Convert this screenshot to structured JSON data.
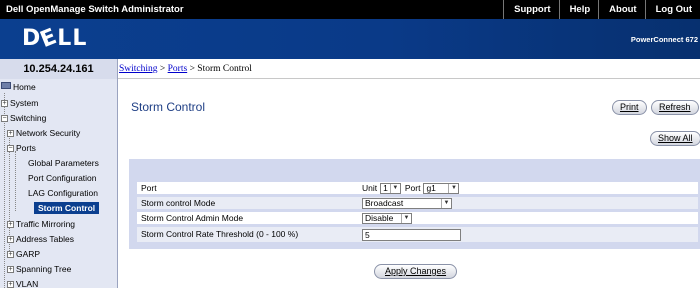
{
  "app": {
    "title": "Dell OpenManage Switch Administrator",
    "nav": [
      "Support",
      "Help",
      "About",
      "Log Out"
    ],
    "logo": "DELL",
    "product": "PowerConnect 672"
  },
  "ip_address": "10.254.24.161",
  "breadcrumb": {
    "items": [
      "Switching",
      "Ports"
    ],
    "separator": ">",
    "current": "Storm Control"
  },
  "sidebar": {
    "items": [
      {
        "label": "Home",
        "icon": "home-icon"
      },
      {
        "label": "System",
        "toggle": "+"
      },
      {
        "label": "Switching",
        "toggle": "−"
      },
      {
        "label": "Network Security",
        "toggle": "+"
      },
      {
        "label": "Ports",
        "toggle": "−"
      },
      {
        "label": "Global Parameters"
      },
      {
        "label": "Port Configuration"
      },
      {
        "label": "LAG Configuration"
      },
      {
        "label": "Storm Control",
        "selected": true
      },
      {
        "label": "Traffic Mirroring",
        "toggle": "+"
      },
      {
        "label": "Address Tables",
        "toggle": "+"
      },
      {
        "label": "GARP",
        "toggle": "+"
      },
      {
        "label": "Spanning Tree",
        "toggle": "+"
      },
      {
        "label": "VLAN",
        "toggle": "+"
      }
    ]
  },
  "main": {
    "title": "Storm Control",
    "buttons": {
      "print": "Print",
      "refresh": "Refresh",
      "show_all": "Show All",
      "apply": "Apply Changes"
    },
    "form": {
      "port_label": "Port",
      "unit_label": "Unit",
      "unit_value": "1",
      "port_inline_label": "Port",
      "port_value": "g1",
      "mode_label": "Storm control Mode",
      "mode_value": "Broadcast",
      "admin_label": "Storm Control Admin Mode",
      "admin_value": "Disable",
      "threshold_label": "Storm Control Rate Threshold (0 - 100 %)",
      "threshold_value": "5"
    }
  },
  "colors": {
    "banner": "#0b3f8f",
    "title_text": "#1f3f85",
    "sidebar_bg": "#e3e7f3",
    "panel_bg": "#d2d8ee",
    "link": "#0000cc"
  }
}
